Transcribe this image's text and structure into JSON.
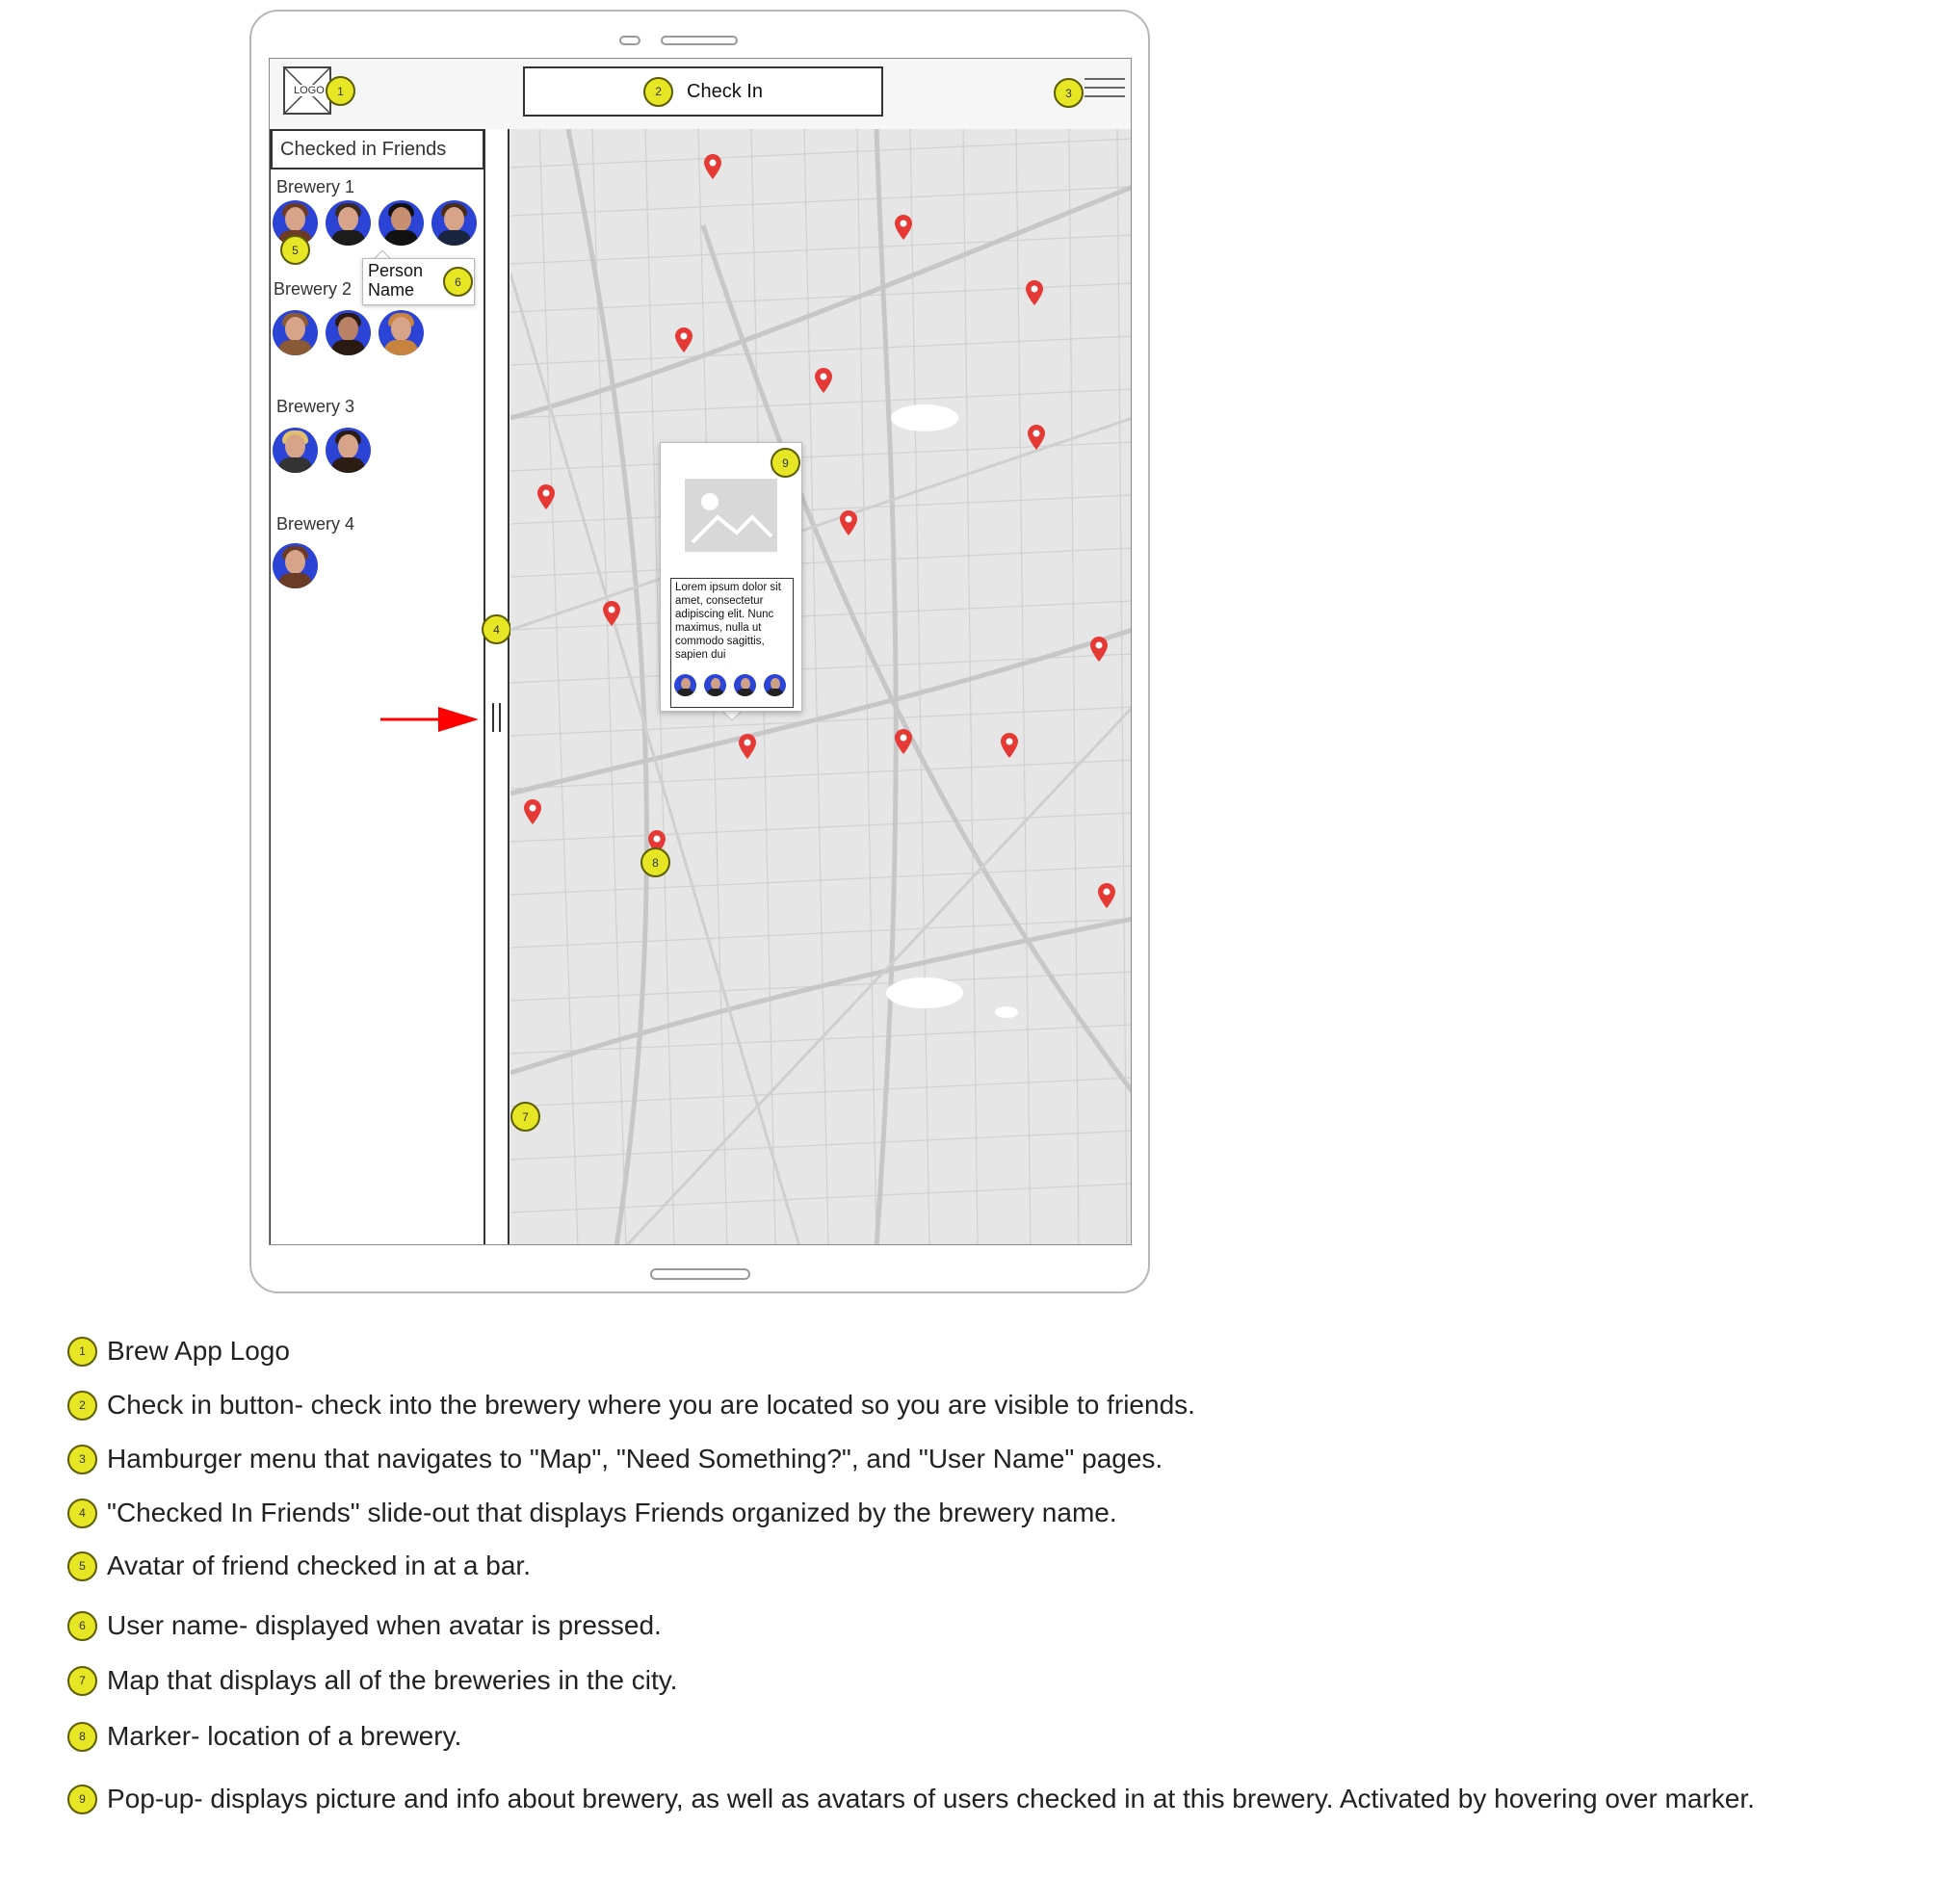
{
  "header": {
    "logo_text": "LOGO",
    "checkin_label": "Check In"
  },
  "sidebar": {
    "title": "Checked in Friends",
    "breweries": [
      {
        "name": "Brewery 1"
      },
      {
        "name": "Brewery 2"
      },
      {
        "name": "Brewery 3"
      },
      {
        "name": "Brewery 4"
      }
    ],
    "tooltip_name": "Person Name"
  },
  "popup": {
    "text": "Lorem ipsum dolor sit amet, consectetur adipiscing elit. Nunc maximus, nulla ut commodo sagittis, sapien dui"
  },
  "badges": [
    "1",
    "2",
    "3",
    "4",
    "5",
    "6",
    "7",
    "8",
    "9"
  ],
  "legend": [
    {
      "num": "1",
      "text": "Brew App Logo"
    },
    {
      "num": "2",
      "text": "Check in button- check into the brewery where you are located so you are visible to friends."
    },
    {
      "num": "3",
      "text": "Hamburger menu that navigates to \"Map\", \"Need Something?\", and \"User Name\" pages."
    },
    {
      "num": "4",
      "text": "\"Checked In Friends\" slide-out  that displays Friends organized by the brewery name."
    },
    {
      "num": "5",
      "text": "Avatar of friend checked in at a bar."
    },
    {
      "num": "6",
      "text": "User name- displayed when avatar is pressed."
    },
    {
      "num": "7",
      "text": "Map that displays all of the breweries in the city."
    },
    {
      "num": "8",
      "text": "Marker- location of a brewery."
    },
    {
      "num": "9",
      "text": "Pop-up- displays picture and info about brewery, as well as avatars of users checked in at this brewery. Activated by hovering over marker."
    }
  ],
  "colors": {
    "badge": "#e6e624",
    "avatar_bg": "#2b44d6",
    "marker": "#e53935",
    "map_bg": "#e6e6e6",
    "arrow": "#ff0000"
  },
  "icons": [
    "logo-placeholder-icon",
    "hamburger-icon",
    "map-marker-icon",
    "image-placeholder-icon",
    "drawer-grip-icon",
    "red-arrow-icon"
  ]
}
